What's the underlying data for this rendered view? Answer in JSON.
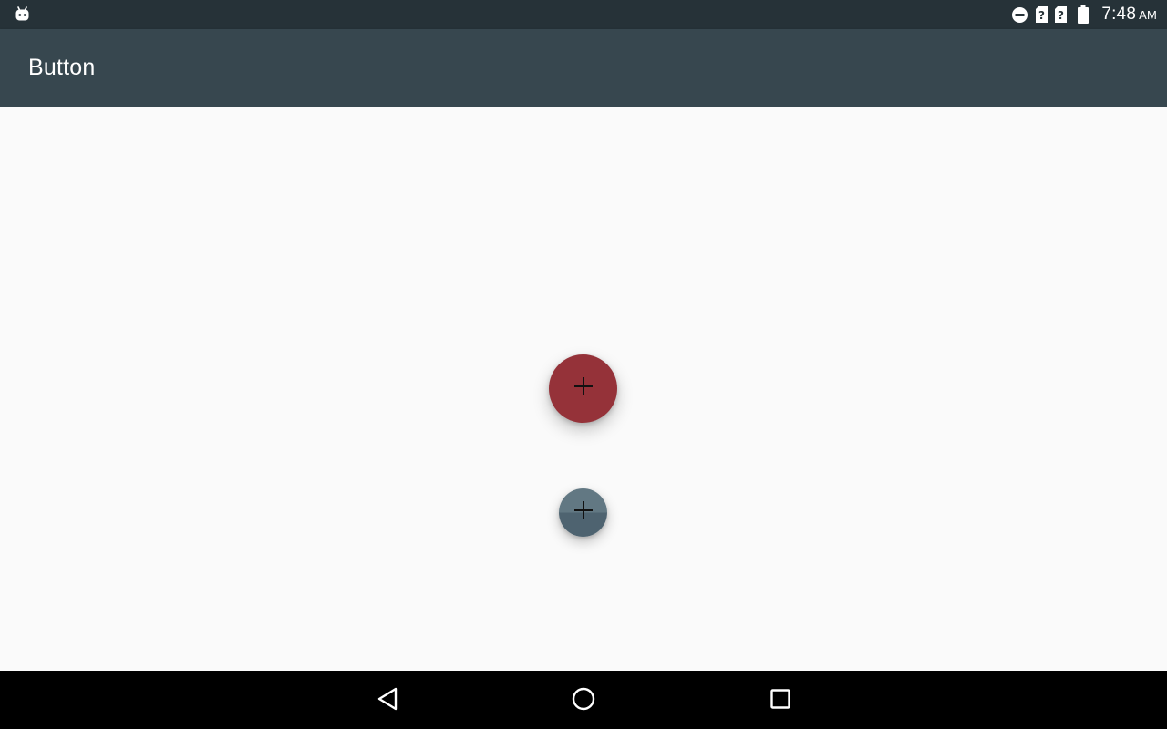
{
  "status_bar": {
    "left_icon": "android-icon",
    "right_icons": [
      "do-not-disturb-icon",
      "sim-unknown-icon",
      "sim-unknown-icon",
      "battery-icon"
    ],
    "time": "7:48",
    "ampm": "AM"
  },
  "app_bar": {
    "title": "Button"
  },
  "main": {
    "fab_large": {
      "icon": "plus-icon",
      "color": "#953239"
    },
    "fab_small": {
      "icon": "plus-icon",
      "color": "#627883"
    }
  },
  "nav_bar": {
    "buttons": [
      "back-icon",
      "home-icon",
      "recents-icon"
    ]
  },
  "colors": {
    "status_bar": "#263238",
    "app_bar": "#37474f",
    "background": "#fafafa"
  }
}
